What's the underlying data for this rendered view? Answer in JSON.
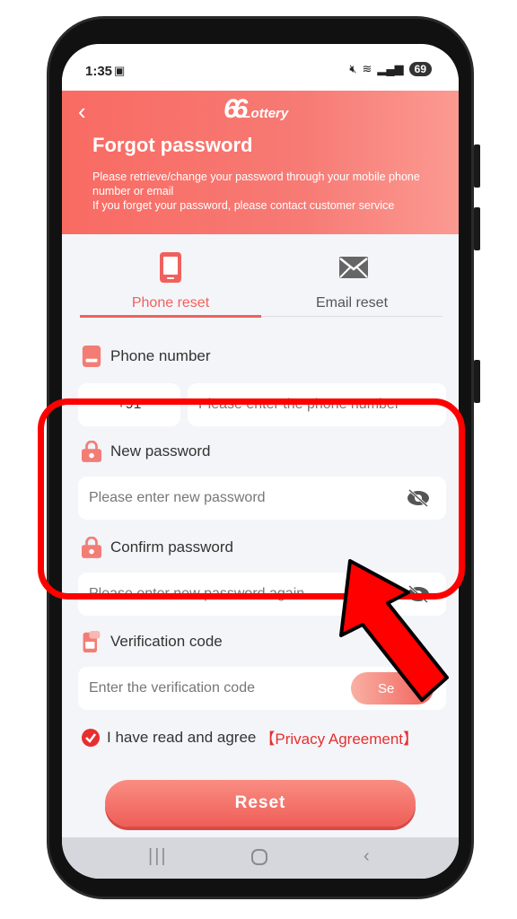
{
  "status": {
    "time": "1:35",
    "screen_icon": "screenshot-icon",
    "battery": "69"
  },
  "header": {
    "back_icon": "chevron-left-icon",
    "logo_number": "66",
    "logo_word": "Lottery",
    "title": "Forgot password",
    "line1": "Please retrieve/change your password through your mobile phone number or email",
    "line2": "If you forget your password, please contact customer service"
  },
  "tabs": [
    {
      "label": "Phone reset",
      "icon": "phone-icon",
      "active": true
    },
    {
      "label": "Email reset",
      "icon": "envelope-icon",
      "active": false
    }
  ],
  "form": {
    "phone_label": "Phone number",
    "country_code": "+91",
    "phone_placeholder": "Please enter the phone number",
    "new_password_label": "New password",
    "new_password_placeholder": "Please enter new password",
    "confirm_password_label": "Confirm password",
    "confirm_password_placeholder": "Please enter new password again",
    "verification_label": "Verification code",
    "verification_placeholder": "Enter the verification code",
    "send_label": "Se"
  },
  "agreement": {
    "text": "I have read and agree",
    "link": "【Privacy Agreement】"
  },
  "reset_label": "Reset",
  "colors": {
    "accent": "#f0615e",
    "annotation": "#ff0000"
  }
}
